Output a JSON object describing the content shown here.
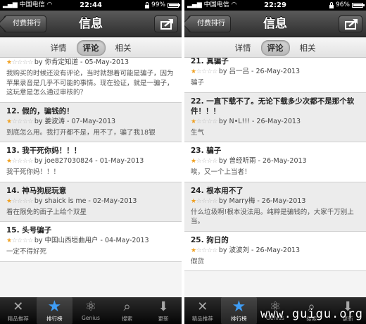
{
  "phones": [
    {
      "status": {
        "carrier": "中国电信",
        "time": "22:44",
        "battery": "99%",
        "battery_level": 0.99
      },
      "nav": {
        "back_label": "付费排行",
        "title": "信息"
      },
      "segments": [
        "详情",
        "评论",
        "相关"
      ],
      "active_segment": 1,
      "reviews": [
        {
          "title": "",
          "rating": 1,
          "meta": "by 你肯定知道 - 05-May-2013",
          "body": "我购买的时候还没有评论，当时就想着可能是骗子，因为苹果录音是几乎不可能的事情。现在验证，就是一骗子，这玩意是怎么通过审核的？"
        },
        {
          "title": "12. 假的，骗钱的！",
          "rating": 1,
          "meta": "by 姜波涛 - 07-May-2013",
          "body": "到底怎么用。我打开都不是，用不了，骗了我18银"
        },
        {
          "title": "13. 我干死你妈！！！",
          "rating": 1,
          "meta": "by joe827030824 - 01-May-2013",
          "body": "我干死你妈！！！"
        },
        {
          "title": "14. 神马狗屁玩意",
          "rating": 1,
          "meta": "by shaick is me - 02-May-2013",
          "body": "看在限免的面子上给个双星"
        },
        {
          "title": "15. 头号骗子",
          "rating": 1,
          "meta": "by 中国山西垣曲用户 - 04-May-2013",
          "body": "一定不得好死"
        }
      ]
    },
    {
      "status": {
        "carrier": "中国电信",
        "time": "22:29",
        "battery": "96%",
        "battery_level": 0.96
      },
      "nav": {
        "back_label": "付费排行",
        "title": "信息"
      },
      "segments": [
        "详情",
        "评论",
        "相关"
      ],
      "active_segment": 1,
      "reviews": [
        {
          "title": "21. 真骗子",
          "rating": 1,
          "meta": "by 吕一吕 - 26-May-2013",
          "body": "骗子"
        },
        {
          "title": "22. 一直下载不了。无论下载多少次都不是那个软件！！！",
          "rating": 1,
          "meta": "by N•L!!! - 26-May-2013",
          "body": "生气"
        },
        {
          "title": "23. 骗子",
          "rating": 1,
          "meta": "by 曾经听雨 - 26-May-2013",
          "body": "唉，又一个上当者！"
        },
        {
          "title": "24. 根本用不了",
          "rating": 1,
          "meta": "by Marry梅 - 26-May-2013",
          "body": "什么垃圾啊!根本没法用。纯粹是骗钱的，大家千万别上当。"
        },
        {
          "title": "25. 狗日的",
          "rating": 1,
          "meta": "by 波波刘 - 26-May-2013",
          "body": "假货"
        }
      ]
    }
  ],
  "tabs": [
    {
      "label": "精品推荐",
      "icon": "featured-icon"
    },
    {
      "label": "排行榜",
      "icon": "star-icon"
    },
    {
      "label": "Genius",
      "icon": "genius-icon"
    },
    {
      "label": "搜索",
      "icon": "search-icon"
    },
    {
      "label": "更新",
      "icon": "updates-icon"
    }
  ],
  "active_tab": 1,
  "watermark": "www.guigu.org",
  "colors": {
    "star_on": "#f0a020",
    "star_off": "#b8b8b8",
    "tab_active_icon": "#3f9df5"
  }
}
